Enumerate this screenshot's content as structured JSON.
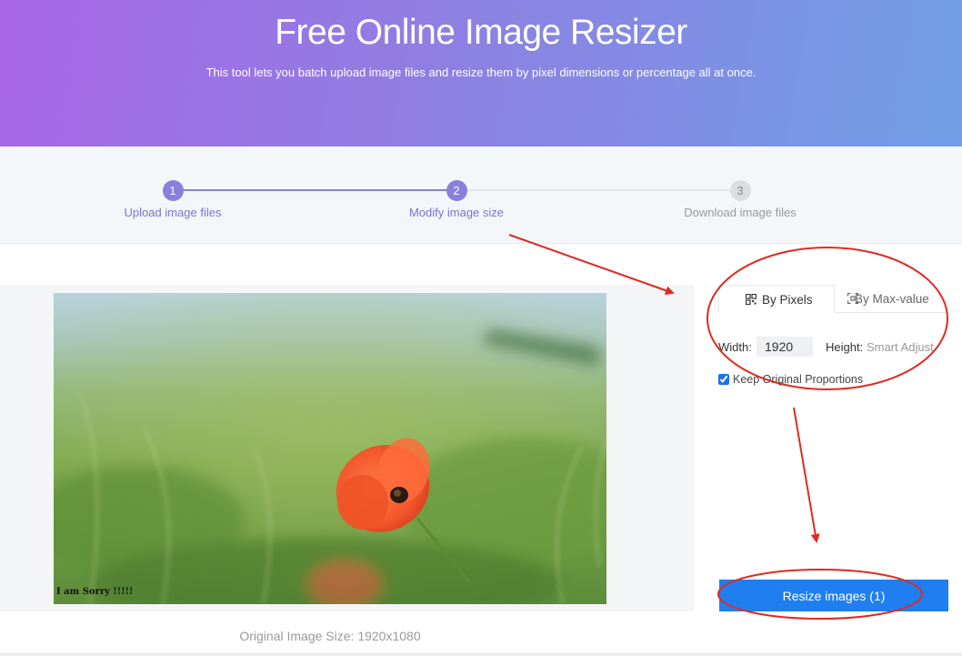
{
  "hero": {
    "title": "Free Online Image Resizer",
    "subtitle": "This tool lets you batch upload image files and resize them by pixel dimensions or percentage all at once."
  },
  "steps": [
    {
      "number": "1",
      "label": "Upload image files",
      "state": "done"
    },
    {
      "number": "2",
      "label": "Modify image size",
      "state": "active"
    },
    {
      "number": "3",
      "label": "Download image files",
      "state": "pending"
    }
  ],
  "preview": {
    "caption": "I am Sorry !!!!!",
    "original_size": "Original Image Size: 1920x1080"
  },
  "tabs": {
    "by_pixels": "By Pixels",
    "by_max_value": "By Max-value",
    "active": "by_pixels"
  },
  "form": {
    "width_label": "Width:",
    "width_value": "1920",
    "height_label": "Height:",
    "height_value": "Smart Adjust",
    "keep_proportions_label": "Keep Original Proportions",
    "keep_proportions_checked": true
  },
  "actions": {
    "resize_label": "Resize images (1)"
  },
  "colors": {
    "accent": "#8a7fdc",
    "button": "#1f7ff0",
    "annotation": "#e02a22"
  }
}
